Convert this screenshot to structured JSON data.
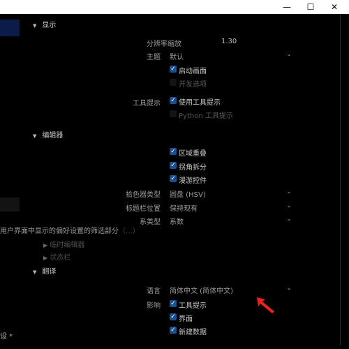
{
  "window": {
    "minimize_icon": "minimize-icon",
    "maximize_icon": "maximize-icon",
    "close_icon": "close-icon",
    "minimize_glyph": "—",
    "maximize_glyph": "☐",
    "close_glyph": "✕"
  },
  "display": {
    "title": "显示",
    "scale_label": "分辨率缩放",
    "scale_value": "1.30",
    "theme_label": "主题",
    "theme_value": "默认",
    "splash_label": "启动画面",
    "devtools_label": "开发选项",
    "tooltips_label": "工具提示",
    "use_tooltips_label": "使用工具提示",
    "python_tooltips_label": "Python 工具提示"
  },
  "editors": {
    "title": "编辑器",
    "region_overlap_label": "区域重叠",
    "corner_split_label": "拐角拆分",
    "nav_controls_label": "漫游控件",
    "color_picker_label": "拾色器类型",
    "color_picker_value": "圆盘 (HSV)",
    "header_pos_label": "标题栏位置",
    "header_pos_value": "保持现有",
    "factor_label": "系类型",
    "factor_value": "系数"
  },
  "hint": {
    "text": "用户界面中显示的偏好设置的筛选部分",
    "tail": "（…）"
  },
  "sub_items": [
    {
      "label": "临时编辑器"
    },
    {
      "label": "状态栏"
    }
  ],
  "translation": {
    "title": "翻译",
    "language_label": "语言",
    "language_value": "简体中文 (简体中文)",
    "affect_label": "影响",
    "affect_tooltips_label": "工具提示",
    "affect_interface_label": "界面",
    "affect_new_data_label": "新建数据"
  },
  "footer": {
    "left_text": "设 *"
  },
  "colors": {
    "accent": "#1b4f8f",
    "arrow": "#e8231e"
  }
}
